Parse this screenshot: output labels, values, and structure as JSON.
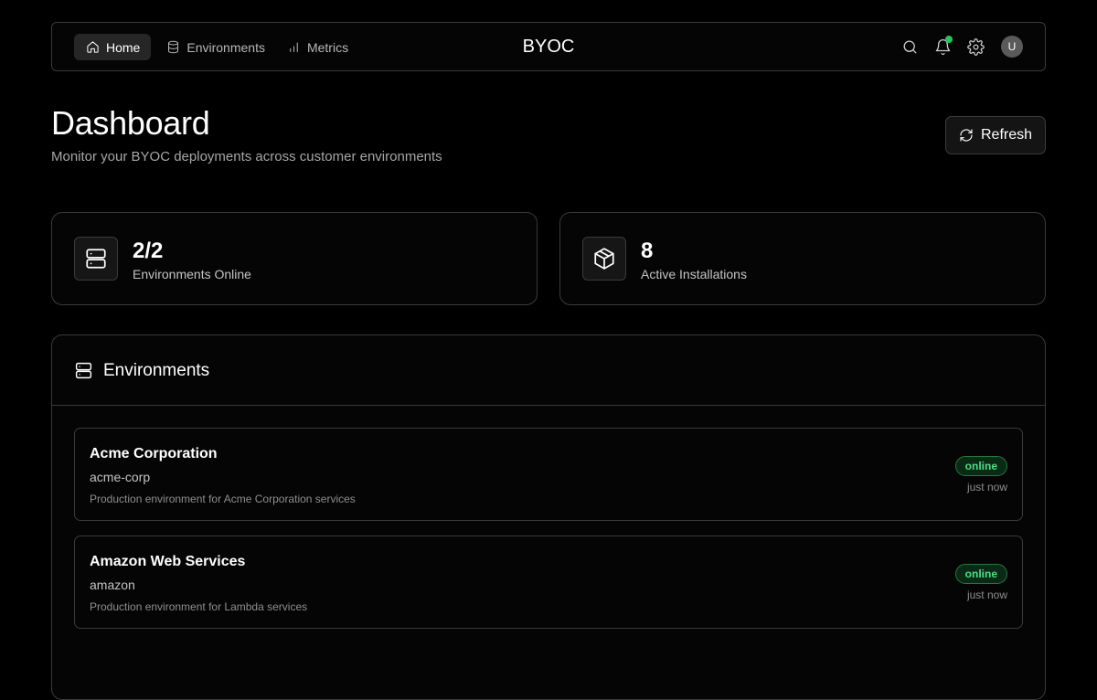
{
  "app": {
    "brand": "BYOC"
  },
  "nav": {
    "items": [
      {
        "label": "Home",
        "icon": "home-icon",
        "active": true
      },
      {
        "label": "Environments",
        "icon": "database-icon",
        "active": false
      },
      {
        "label": "Metrics",
        "icon": "bar-chart-icon",
        "active": false
      }
    ],
    "actions": {
      "search_icon": "search-icon",
      "notifications_icon": "bell-icon",
      "settings_icon": "gear-icon",
      "avatar_initial": "U"
    }
  },
  "header": {
    "title": "Dashboard",
    "subtitle": "Monitor your BYOC deployments across customer environments",
    "refresh_label": "Refresh"
  },
  "stats": [
    {
      "value": "2/2",
      "label": "Environments Online",
      "icon": "server-icon"
    },
    {
      "value": "8",
      "label": "Active Installations",
      "icon": "package-icon"
    }
  ],
  "environments": {
    "title": "Environments",
    "icon": "server-icon",
    "items": [
      {
        "name": "Acme Corporation",
        "slug": "acme-corp",
        "description": "Production environment for Acme Corporation services",
        "status": "online",
        "updated": "just now"
      },
      {
        "name": "Amazon Web Services",
        "slug": "amazon",
        "description": "Production environment for Lambda services",
        "status": "online",
        "updated": "just now"
      }
    ]
  },
  "colors": {
    "background": "#000000",
    "border": "#3a3a3a",
    "status_online": "#4ade80",
    "notification_dot": "#22c55e"
  }
}
